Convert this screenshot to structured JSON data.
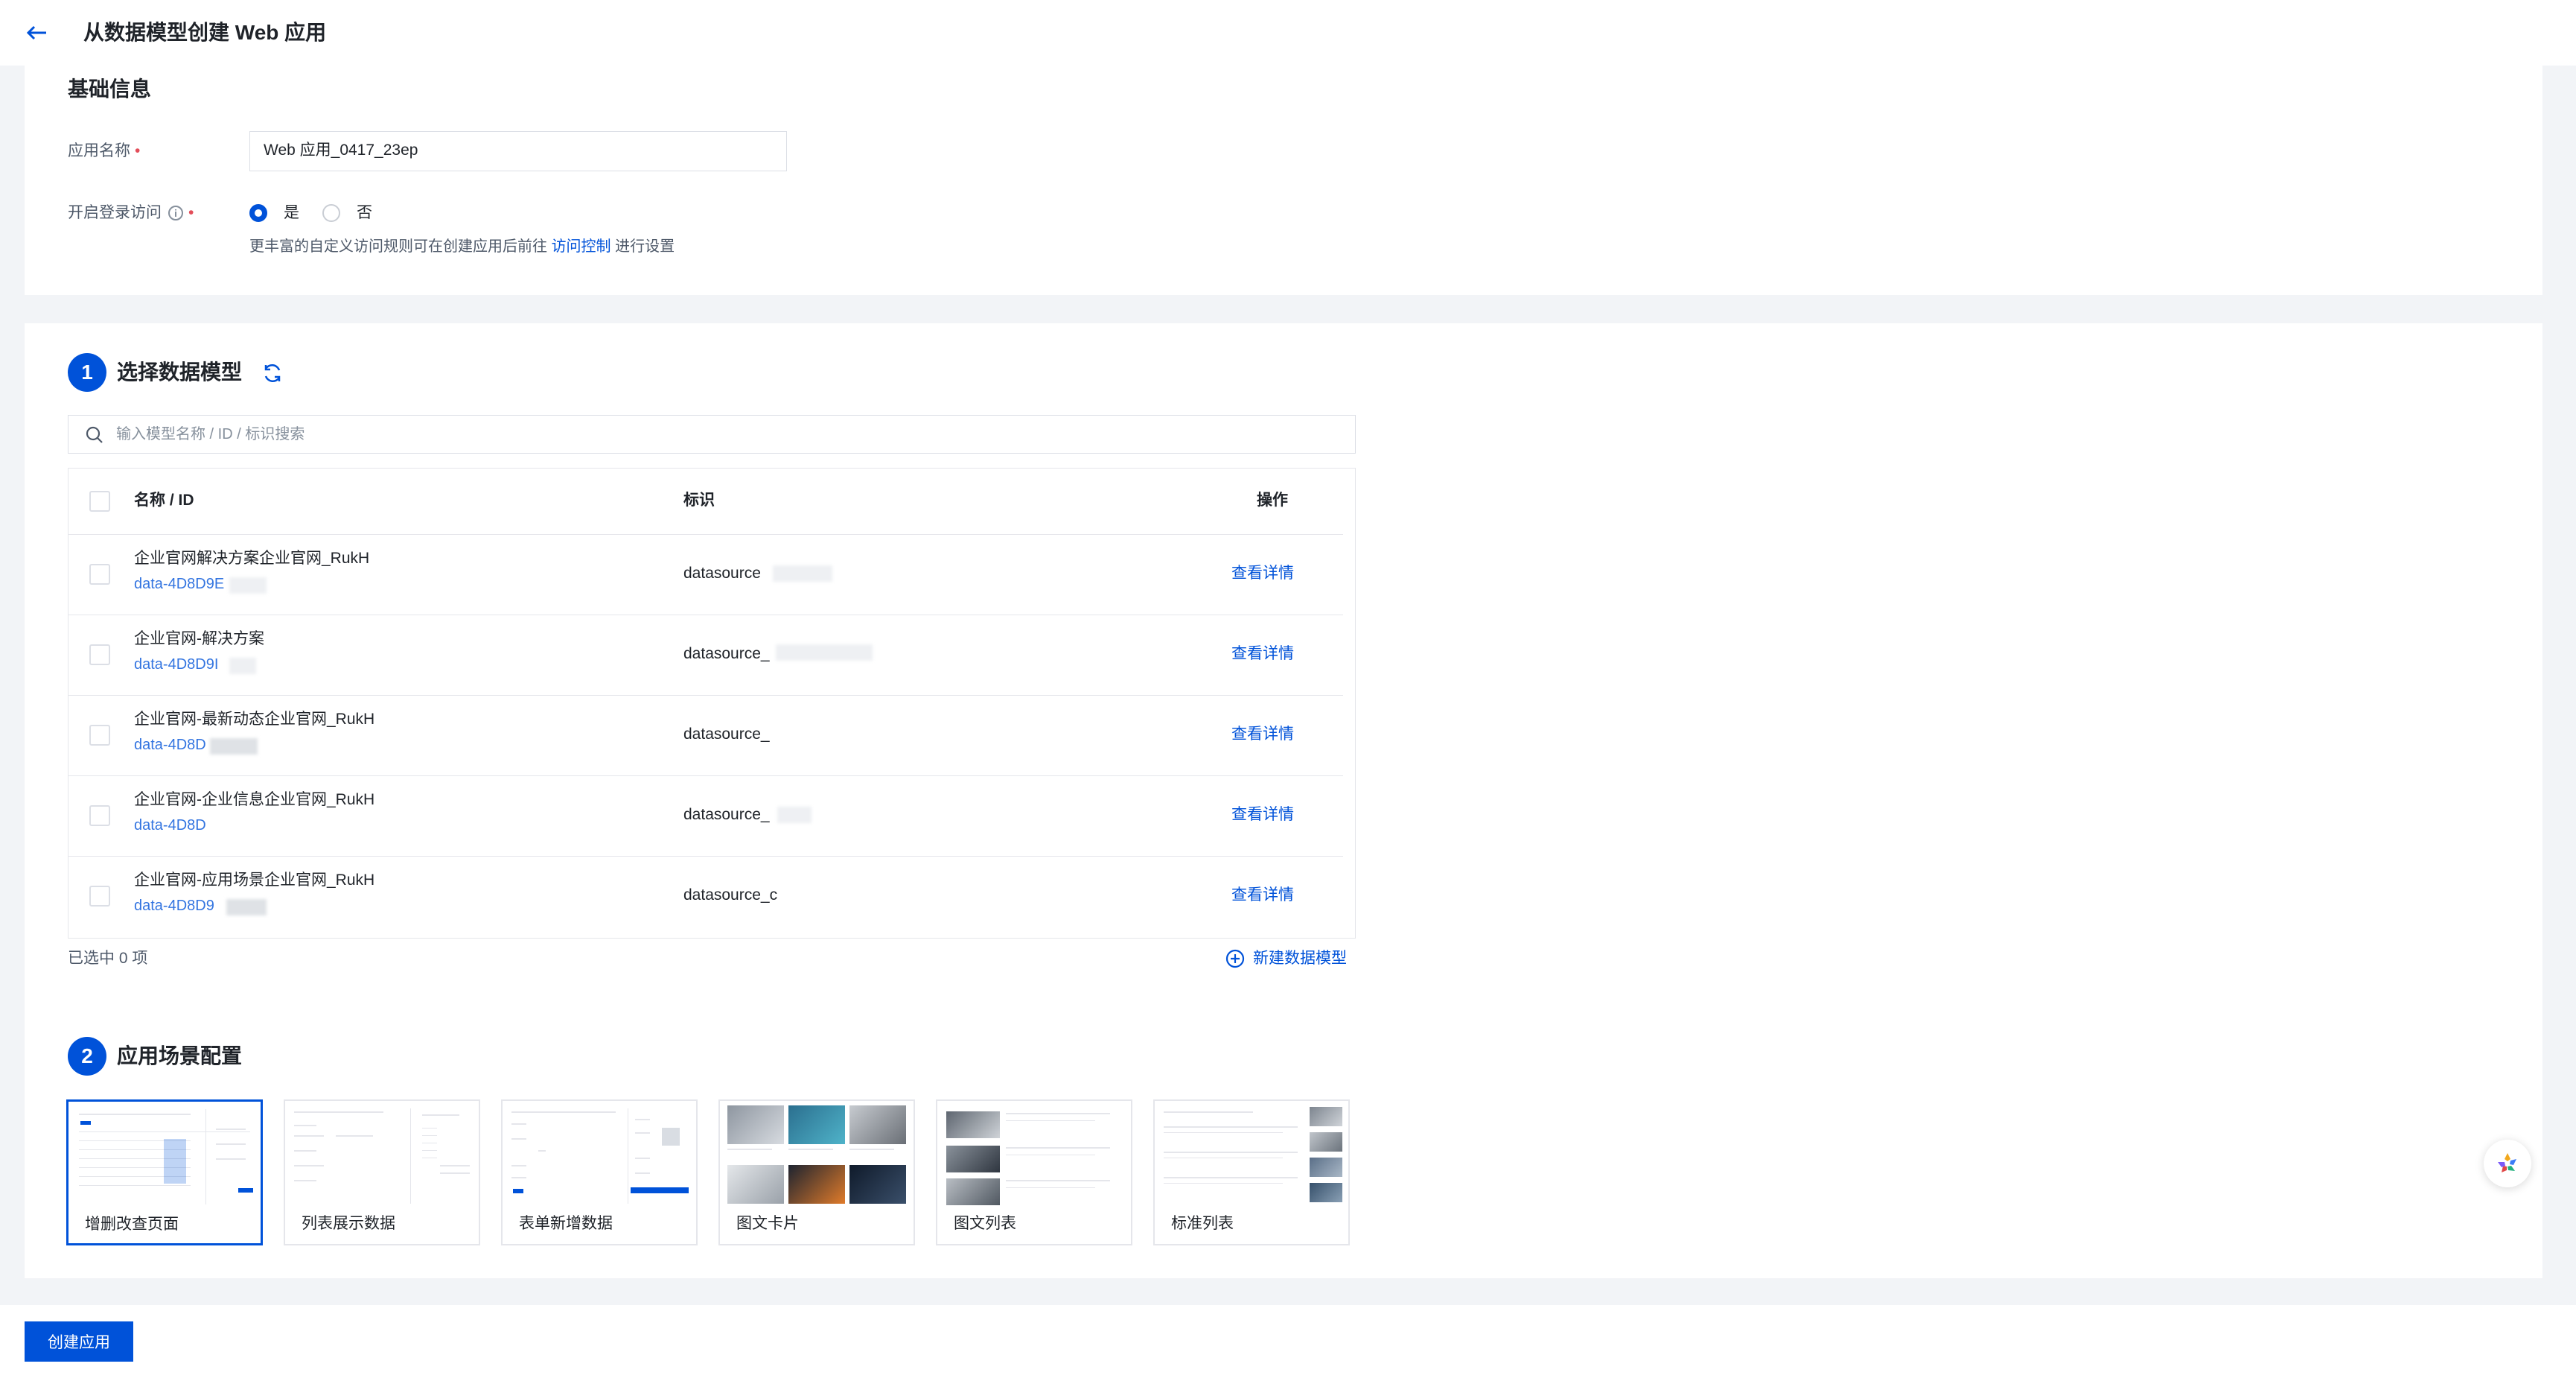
{
  "header": {
    "title": "从数据模型创建 Web 应用"
  },
  "basic": {
    "title": "基础信息",
    "app_name_label": "应用名称",
    "app_name_value": "Web 应用_0417_23ep",
    "login_label": "开启登录访问",
    "login_yes": "是",
    "login_no": "否",
    "login_selected": "是",
    "hint_prefix": "更丰富的自定义访问规则可在创建应用后前往",
    "hint_link": "访问控制",
    "hint_suffix": "进行设置"
  },
  "step1": {
    "number": "1",
    "title": "选择数据模型",
    "search_placeholder": "输入模型名称 / ID / 标识搜索",
    "columns": {
      "name": "名称 / ID",
      "ident": "标识",
      "op": "操作"
    },
    "rows": [
      {
        "name": "企业官网解决方案企业官网_RukH",
        "id": "data-4D8D9E",
        "ident": "datasource",
        "op": "查看详情"
      },
      {
        "name": "企业官网-解决方案",
        "id": "data-4D8D9I",
        "ident": "datasource_",
        "op": "查看详情"
      },
      {
        "name": "企业官网-最新动态企业官网_RukH",
        "id": "data-4D8D",
        "ident": "datasource_",
        "op": "查看详情"
      },
      {
        "name": "企业官网-企业信息企业官网_RukH",
        "id": "data-4D8D",
        "ident": "datasource_",
        "op": "查看详情"
      },
      {
        "name": "企业官网-应用场景企业官网_RukH",
        "id": "data-4D8D9",
        "ident": "datasource_c",
        "op": "查看详情"
      }
    ],
    "selected_count": "已选中 0 项",
    "new_model": "新建数据模型"
  },
  "step2": {
    "number": "2",
    "title": "应用场景配置",
    "templates": [
      {
        "label": "增删改查页面",
        "selected": true
      },
      {
        "label": "列表展示数据",
        "selected": false
      },
      {
        "label": "表单新增数据",
        "selected": false
      },
      {
        "label": "图文卡片",
        "selected": false
      },
      {
        "label": "图文列表",
        "selected": false
      },
      {
        "label": "标准列表",
        "selected": false
      }
    ]
  },
  "footer": {
    "create_button": "创建应用"
  },
  "colors": {
    "accent": "#0052d9",
    "required": "#e34d59"
  },
  "icons": [
    "arrow-left-icon",
    "info-icon",
    "refresh-icon",
    "search-icon",
    "plus-circle-icon",
    "assistant-icon"
  ]
}
